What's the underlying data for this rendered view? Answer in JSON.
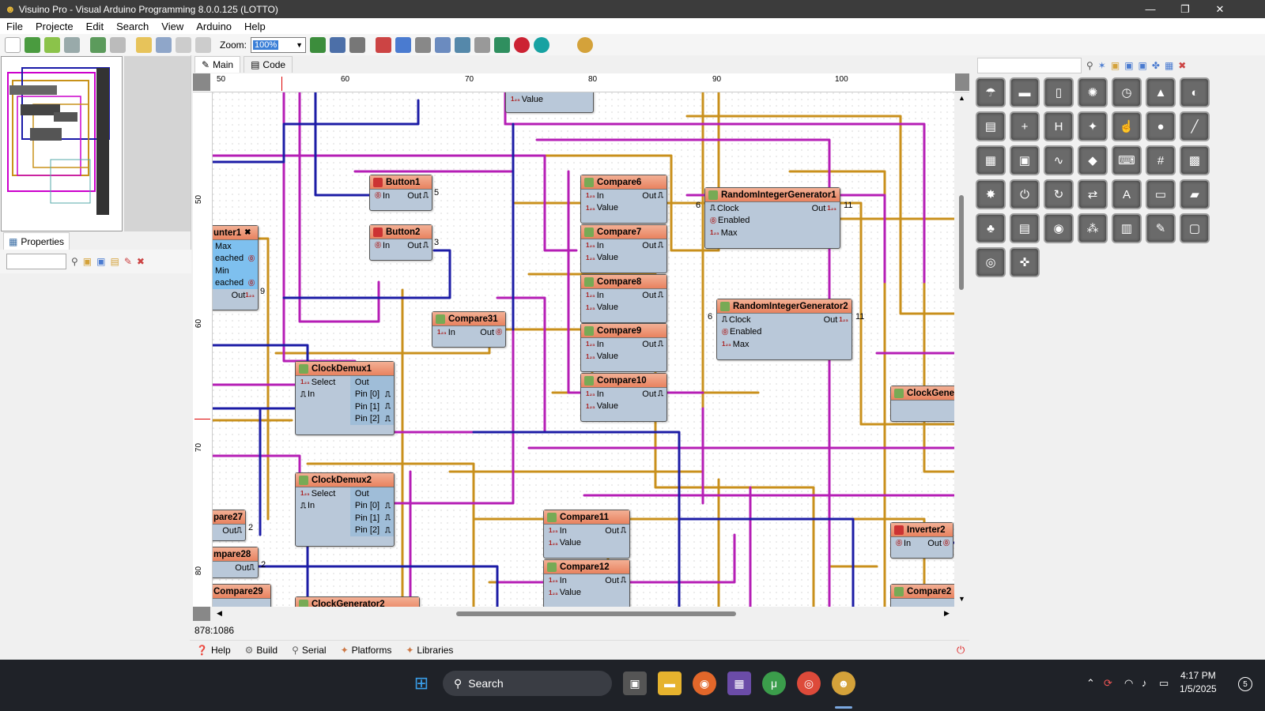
{
  "window": {
    "title": "Visuino Pro - Visual Arduino Programming 8.0.0.125 (LOTTO)",
    "minimize": "—",
    "maximize": "❐",
    "close": "✕"
  },
  "menu": [
    "File",
    "Projecte",
    "Edit",
    "Search",
    "View",
    "Arduino",
    "Help"
  ],
  "toolbar": {
    "zoom_label": "Zoom:",
    "zoom_value": "100%"
  },
  "left": {
    "properties_label": "Properties"
  },
  "tabs": {
    "main": "Main",
    "code": "Code"
  },
  "ruler": {
    "h": [
      "50",
      "60",
      "70",
      "80",
      "90",
      "100"
    ],
    "v": [
      "50",
      "60",
      "70",
      "80"
    ]
  },
  "status": {
    "coords": "878:1086"
  },
  "bottom_tabs": [
    "Help",
    "Build",
    "Serial",
    "Platforms",
    "Libraries"
  ],
  "canvas": {
    "value_top": {
      "label": "Value",
      "tag": "1₂₃"
    },
    "counter": {
      "title": "unter1",
      "pins": [
        "Max",
        "eached",
        "Min",
        "eached",
        "Out"
      ],
      "num": "9"
    },
    "button1": {
      "title": "Button1",
      "in": "In",
      "out": "Out",
      "num": "5"
    },
    "button2": {
      "title": "Button2",
      "in": "In",
      "out": "Out",
      "num": "3"
    },
    "compares": [
      {
        "title": "Compare6",
        "in": "In",
        "value": "Value",
        "out": "Out"
      },
      {
        "title": "Compare7",
        "in": "In",
        "value": "Value",
        "out": "Out"
      },
      {
        "title": "Compare8",
        "in": "In",
        "value": "Value",
        "out": "Out"
      },
      {
        "title": "Compare9",
        "in": "In",
        "value": "Value",
        "out": "Out"
      },
      {
        "title": "Compare10",
        "in": "In",
        "value": "Value",
        "out": "Out"
      },
      {
        "title": "Compare11",
        "in": "In",
        "value": "Value",
        "out": "Out"
      },
      {
        "title": "Compare12",
        "in": "In",
        "value": "Value",
        "out": "Out"
      }
    ],
    "compare31": {
      "title": "Compare31",
      "in": "In",
      "out": "Out"
    },
    "rig1": {
      "title": "RandomIntegerGenerator1",
      "clock": "Clock",
      "enabled": "Enabled",
      "max": "Max",
      "out": "Out",
      "num_in": "6",
      "num_out": "11"
    },
    "rig2": {
      "title": "RandomIntegerGenerator2",
      "clock": "Clock",
      "enabled": "Enabled",
      "max": "Max",
      "out": "Out",
      "num_in": "6",
      "num_out": "11"
    },
    "demux1": {
      "title": "ClockDemux1",
      "select": "Select",
      "in": "In",
      "out": "Out",
      "pins": [
        "Pin [0]",
        "Pin [1]",
        "Pin [2]"
      ]
    },
    "demux2": {
      "title": "ClockDemux2",
      "select": "Select",
      "in": "In",
      "out": "Out",
      "pins": [
        "Pin [0]",
        "Pin [1]",
        "Pin [2]"
      ]
    },
    "pare27": {
      "title": "pare27",
      "out": "Out",
      "num": "2"
    },
    "mpare28": {
      "title": "mpare28",
      "out": "Out",
      "num": "2"
    },
    "compare29": {
      "title": "Compare29"
    },
    "clockgen2": {
      "title": "ClockGenerator2"
    },
    "clockgen_right": {
      "title": "ClockGene"
    },
    "inverter2": {
      "title": "Inverter2",
      "in": "In",
      "out": "Out"
    },
    "compare_right": {
      "title": "Compare2"
    }
  },
  "taskbar": {
    "search": "Search",
    "time": "4:17 PM",
    "date": "1/5/2025",
    "badge": "5"
  }
}
